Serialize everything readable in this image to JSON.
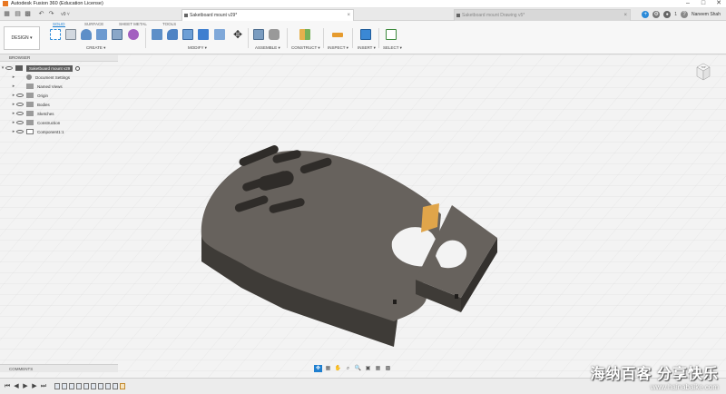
{
  "window": {
    "title": "Autodesk Fusion 360 (Education License)",
    "minimize": "–",
    "maximize": "□",
    "close": "✕"
  },
  "tabs": [
    {
      "label": "Saketboard mount v29*",
      "close": "×"
    },
    {
      "label": "Saketboard mount Drawing v5*",
      "close": "×"
    }
  ],
  "topbar": {
    "version": "v9 ˅",
    "job_count": "1",
    "user": "Naneem Shah"
  },
  "toolbar": {
    "workspace": "DESIGN ▾",
    "workspace_tabs": [
      "SOLID",
      "SURFACE",
      "SHEET METAL",
      "TOOLS"
    ],
    "groups": [
      "CREATE ▾",
      "MODIFY ▾",
      "ASSEMBLE ▾",
      "CONSTRUCT ▾",
      "INSPECT ▾",
      "INSERT ▾",
      "SELECT ▾"
    ]
  },
  "browser": {
    "header": "BROWSER",
    "root": "Saketboard mount v29",
    "items": [
      "Document Settings",
      "Named Views",
      "Origin",
      "Bodies",
      "Sketches",
      "Construction",
      "Component1:1"
    ]
  },
  "viewcube": {
    "label": "TOP"
  },
  "comments": {
    "label": "COMMENTS"
  },
  "watermark": {
    "main": "海纳百客 分享快乐",
    "sub": "www.hainabaike.com"
  },
  "colors": {
    "accent": "#1f7fcf",
    "part_top": "#67625d",
    "part_side": "#3e3b37",
    "highlight": "#e0a54a"
  }
}
